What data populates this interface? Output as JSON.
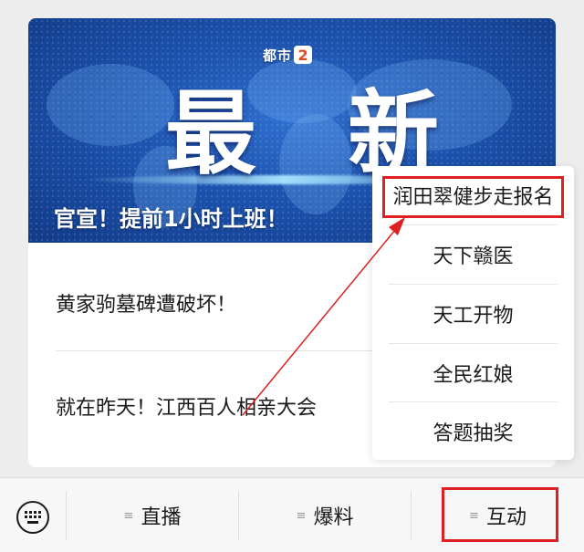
{
  "card": {
    "banner": {
      "logo_text": "都市",
      "logo_number": "2",
      "headline_chars": [
        "最",
        "新"
      ],
      "caption": "官宣！提前1小时上班！"
    },
    "articles": [
      {
        "title": "黄家驹墓碑遭破坏！"
      },
      {
        "title": "就在昨天！江西百人相亲大会"
      }
    ]
  },
  "popup_menu": {
    "items": [
      {
        "label": "润田翠健步走报名"
      },
      {
        "label": "天下赣医"
      },
      {
        "label": "天工开物"
      },
      {
        "label": "全民红娘"
      },
      {
        "label": "答题抽奖"
      }
    ]
  },
  "bottom_bar": {
    "keyboard_icon": "keyboard-icon",
    "tabs": [
      {
        "label": "直播",
        "icon": "menu-lines-icon"
      },
      {
        "label": "爆料",
        "icon": "menu-lines-icon"
      },
      {
        "label": "互动",
        "icon": "menu-lines-icon"
      }
    ]
  },
  "colors": {
    "annotation_red": "#e02020",
    "banner_blue": "#1d52ad",
    "page_bg": "#ededed"
  }
}
